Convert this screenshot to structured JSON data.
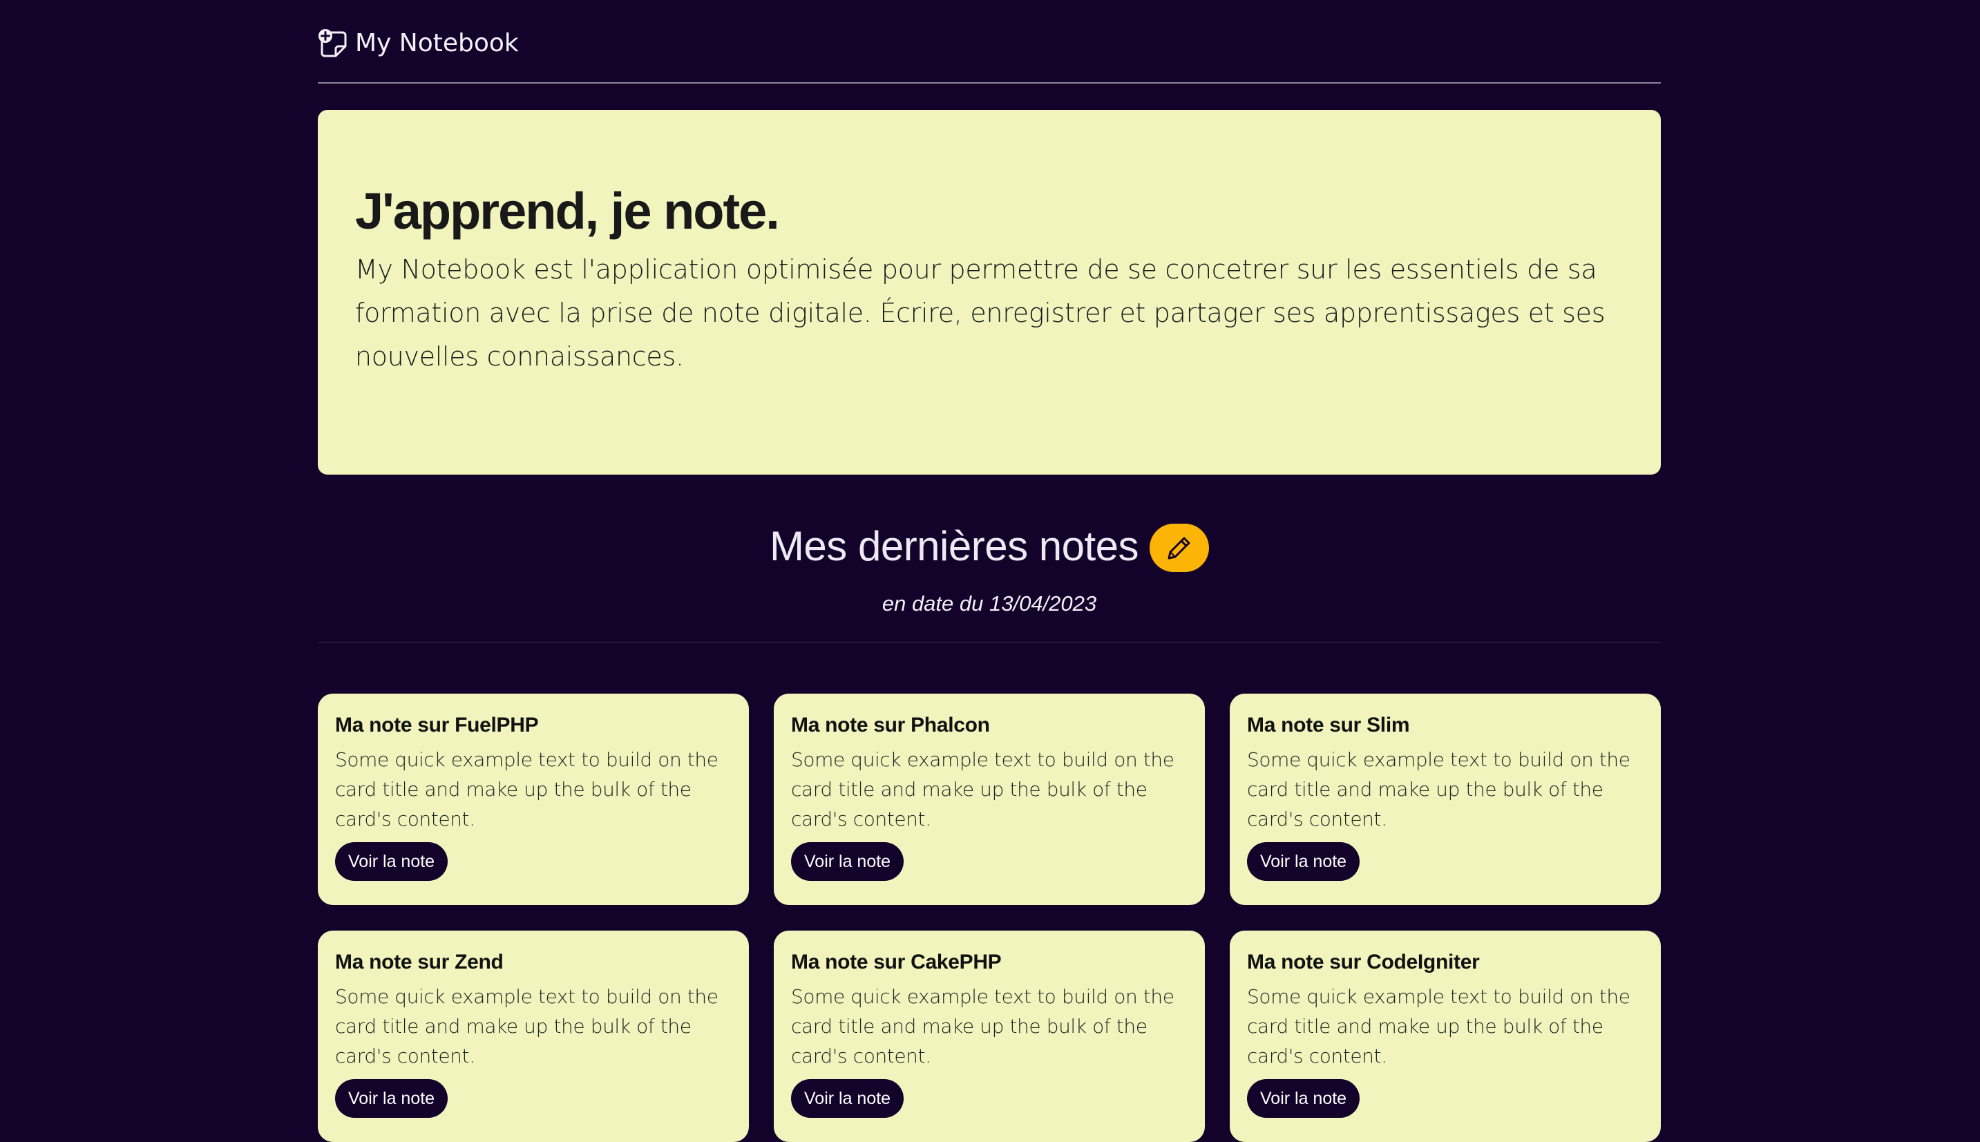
{
  "brand": {
    "name": "My Notebook",
    "icon": "sticky-note-plus-icon"
  },
  "hero": {
    "title": "J'apprend, je note.",
    "lead": "My Notebook est l'application optimisée pour permettre de se concetrer sur les essentiels de sa formation avec la prise de note digitale. Écrire, enregistrer et partager ses apprentissages et ses nouvelles connaissances."
  },
  "notes_section": {
    "title": "Mes dernières notes",
    "edit_icon": "pencil-icon",
    "date": "en date du 13/04/2023"
  },
  "cards": [
    {
      "title": "Ma note sur FuelPHP",
      "text": "Some quick example text to build on the card title and make up the bulk of the card's content.",
      "button": "Voir la note"
    },
    {
      "title": "Ma note sur Phalcon",
      "text": "Some quick example text to build on the card title and make up the bulk of the card's content.",
      "button": "Voir la note"
    },
    {
      "title": "Ma note sur Slim",
      "text": "Some quick example text to build on the card title and make up the bulk of the card's content.",
      "button": "Voir la note"
    },
    {
      "title": "Ma note sur Zend",
      "text": "Some quick example text to build on the card title and make up the bulk of the card's content.",
      "button": "Voir la note"
    },
    {
      "title": "Ma note sur CakePHP",
      "text": "Some quick example text to build on the card title and make up the bulk of the card's content.",
      "button": "Voir la note"
    },
    {
      "title": "Ma note sur CodeIgniter",
      "text": "Some quick example text to build on the card title and make up the bulk of the card's content.",
      "button": "Voir la note"
    }
  ],
  "colors": {
    "background": "#13022a",
    "card": "#f1f4bd",
    "accent": "#fcb407"
  }
}
